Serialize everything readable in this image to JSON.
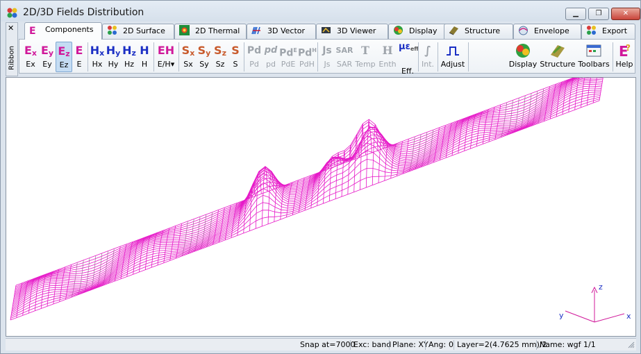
{
  "window": {
    "title": "2D/3D Fields Distribution"
  },
  "ribbon": {
    "close_glyph": "✕",
    "label": "Ribbon"
  },
  "tabs": [
    {
      "label": "Components",
      "icon": "e-letter-icon",
      "active": true
    },
    {
      "label": "2D Surface",
      "icon": "surface-icon"
    },
    {
      "label": "2D Thermal",
      "icon": "thermal-icon"
    },
    {
      "label": "3D Vector",
      "icon": "vector-icon"
    },
    {
      "label": "3D Viewer",
      "icon": "viewer-icon"
    },
    {
      "label": "Display",
      "icon": "display-icon"
    },
    {
      "label": "Structure",
      "icon": "structure-icon"
    },
    {
      "label": "Envelope",
      "icon": "envelope-icon"
    },
    {
      "label": "Export",
      "icon": "export-icon"
    }
  ],
  "toolbar": {
    "ex": {
      "label": "Ex",
      "glyph": "E",
      "sub": "x"
    },
    "ey": {
      "label": "Ey",
      "glyph": "E",
      "sub": "y"
    },
    "ez": {
      "label": "Ez",
      "glyph": "E",
      "sub": "z"
    },
    "e": {
      "label": "E",
      "glyph": "E"
    },
    "hx": {
      "label": "Hx",
      "glyph": "H",
      "sub": "x"
    },
    "hy": {
      "label": "Hy",
      "glyph": "H",
      "sub": "y"
    },
    "hz": {
      "label": "Hz",
      "glyph": "H",
      "sub": "z"
    },
    "h": {
      "label": "H",
      "glyph": "H"
    },
    "eh": {
      "label": "E/H",
      "glyph": "EH",
      "dropdown": "▾"
    },
    "sx": {
      "label": "Sx",
      "glyph": "S",
      "sub": "x"
    },
    "sy": {
      "label": "Sy",
      "glyph": "S",
      "sub": "y"
    },
    "sz": {
      "label": "Sz",
      "glyph": "S",
      "sub": "z"
    },
    "s": {
      "label": "S",
      "glyph": "S"
    },
    "pd_big": {
      "label": "Pd",
      "glyph": "Pd"
    },
    "pd_small": {
      "label": "pd",
      "glyph": "pd"
    },
    "pde": {
      "label": "PdE",
      "glyph": "Pd",
      "sup": "E"
    },
    "pdh": {
      "label": "PdH",
      "glyph": "Pd",
      "sup": "H"
    },
    "js": {
      "label": "Js",
      "glyph": "Js"
    },
    "sar": {
      "label": "SAR",
      "glyph": "SAR"
    },
    "temp": {
      "label": "Temp",
      "glyph": "T"
    },
    "enth": {
      "label": "Enth",
      "glyph": "H"
    },
    "eff": {
      "label": "Eff.",
      "glyph": "με",
      "sub": "eff"
    },
    "int": {
      "label": "Int.",
      "glyph": "∫"
    },
    "adjust": {
      "label": "Adjust"
    },
    "display": {
      "label": "Display"
    },
    "structure": {
      "label": "Structure"
    },
    "toolbars": {
      "label": "Toolbars"
    },
    "help": {
      "label": "Help"
    }
  },
  "colors": {
    "mesh_top": "#e619c8",
    "mesh_under": "#9a9a9a",
    "axes": "#d0189a"
  },
  "axes": {
    "x": "x",
    "y": "y",
    "z": "z"
  },
  "status": {
    "snap": "Snap at=7000",
    "exc": "Exc: band",
    "plane": "Plane: XY",
    "ang_label": "Ang:",
    "ang_value": "0",
    "layer": "Layer=2(4.7625 mm)/2",
    "name": "Name: wgf 1/1"
  }
}
